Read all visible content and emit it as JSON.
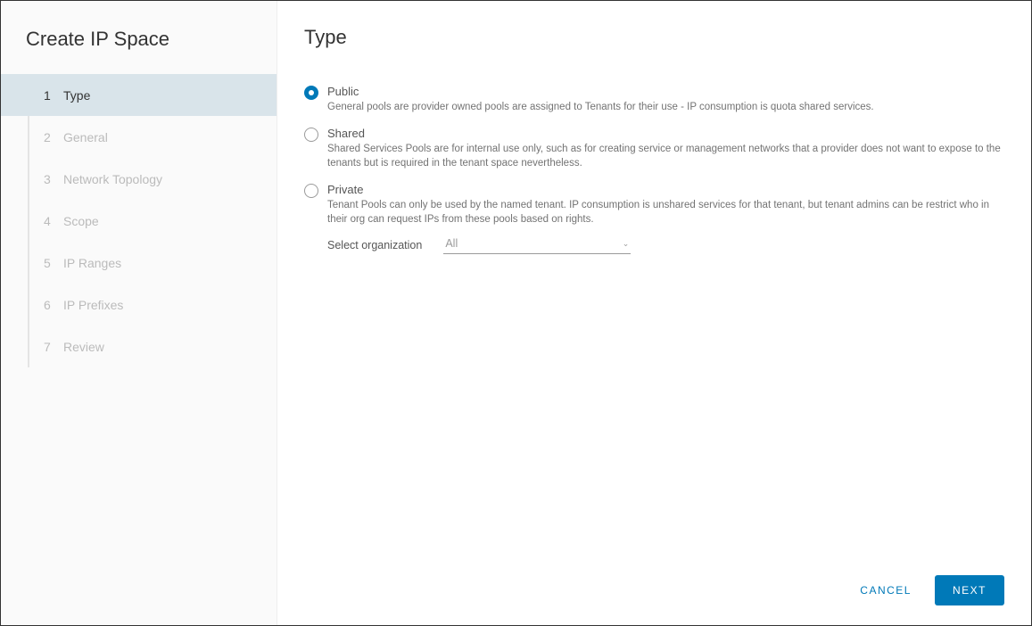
{
  "wizard": {
    "title": "Create IP Space",
    "steps": [
      {
        "num": "1",
        "label": "Type",
        "active": true
      },
      {
        "num": "2",
        "label": "General",
        "active": false
      },
      {
        "num": "3",
        "label": "Network Topology",
        "active": false
      },
      {
        "num": "4",
        "label": "Scope",
        "active": false
      },
      {
        "num": "5",
        "label": "IP Ranges",
        "active": false
      },
      {
        "num": "6",
        "label": "IP Prefixes",
        "active": false
      },
      {
        "num": "7",
        "label": "Review",
        "active": false
      }
    ]
  },
  "page": {
    "title": "Type",
    "options": {
      "public": {
        "label": "Public",
        "desc": "General pools are provider owned pools are assigned to Tenants for their use - IP consumption is quota shared services.",
        "selected": true
      },
      "shared": {
        "label": "Shared",
        "desc": "Shared Services Pools are for internal use only, such as for creating service or management networks that a provider does not want to expose to the tenants but is required in the tenant space nevertheless.",
        "selected": false
      },
      "private": {
        "label": "Private",
        "desc": "Tenant Pools can only be used by the named tenant. IP consumption is unshared services for that tenant, but tenant admins can be restrict who in their org can request IPs from these pools based on rights.",
        "selected": false,
        "select_label": "Select organization",
        "select_value": "All"
      }
    }
  },
  "footer": {
    "cancel": "CANCEL",
    "next": "NEXT"
  }
}
